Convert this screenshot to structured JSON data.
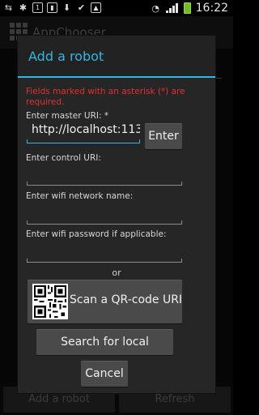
{
  "status_bar": {
    "time": "16:22",
    "icons": [
      "usb-icon",
      "debug-icon",
      "notification-1-icon",
      "sd-icon",
      "download-icon",
      "check-icon",
      "image-icon",
      "wifi-icon",
      "signal-icon",
      "battery-icon"
    ],
    "badge_1": "1"
  },
  "app": {
    "title": "AppChooser",
    "bottom_left_label": "Add a robot",
    "bottom_right_label": "Refresh"
  },
  "dialog": {
    "title": "Add a robot",
    "accent_color": "#33b5e5",
    "warning": "Fields marked with an asterisk (*) are required.",
    "master_uri_label": "Enter master URI: *",
    "master_uri_value": "http://localhost:113",
    "enter_label": "Enter",
    "control_uri_label": "Enter control URI:",
    "control_uri_value": "",
    "wifi_name_label": "Enter wifi network name:",
    "wifi_name_value": "",
    "wifi_password_label": "Enter wifi password if applicable:",
    "wifi_password_value": "",
    "or_label": "or",
    "qr_label": "Scan a QR-code URI",
    "search_label": "Search for local network",
    "cancel_label": "Cancel"
  }
}
